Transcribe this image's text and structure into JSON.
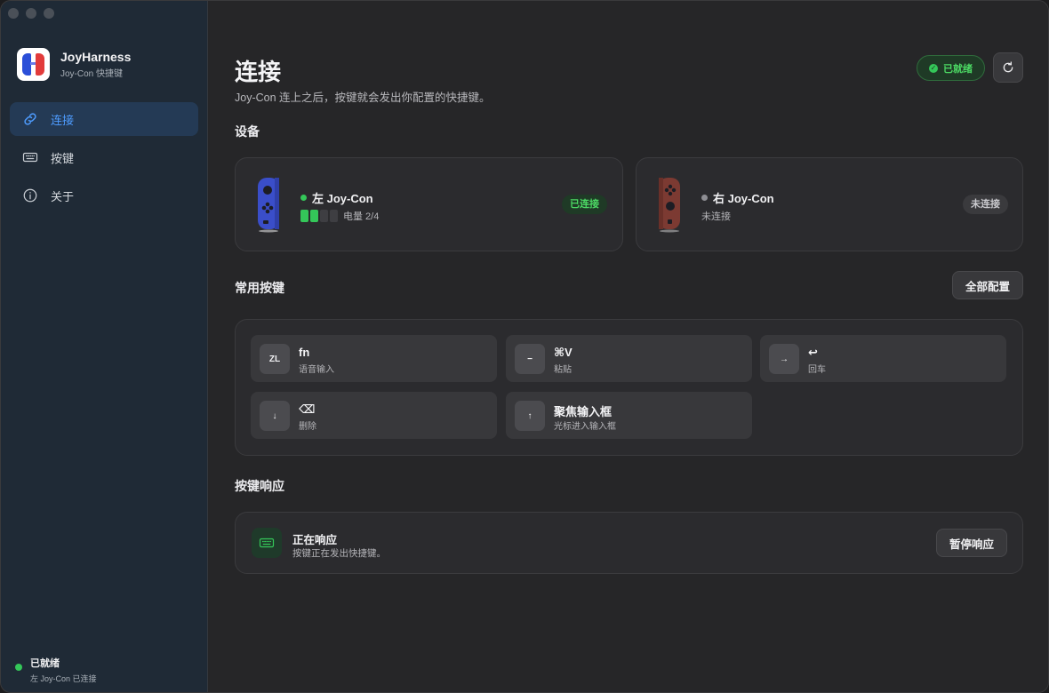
{
  "app": {
    "name": "JoyHarness",
    "subtitle": "Joy-Con 快捷键"
  },
  "sidebar": {
    "items": [
      {
        "label": "连接",
        "icon": "link-icon",
        "active": true
      },
      {
        "label": "按键",
        "icon": "keyboard-icon",
        "active": false
      },
      {
        "label": "关于",
        "icon": "info-icon",
        "active": false
      }
    ],
    "status": {
      "title": "已就绪",
      "detail": "左 Joy-Con 已连接"
    }
  },
  "header": {
    "title": "连接",
    "subtitle": "Joy-Con 连上之后，按键就会发出你配置的快捷键。",
    "status_pill": "已就绪"
  },
  "devices": {
    "section_title": "设备",
    "left": {
      "name": "左 Joy-Con",
      "battery_label": "电量 2/4",
      "battery_level": 2,
      "battery_max": 4,
      "badge": "已连接",
      "status_color": "#34c759"
    },
    "right": {
      "name": "右 Joy-Con",
      "status_text": "未连接",
      "badge": "未连接",
      "status_color": "#8e8e93"
    }
  },
  "shortcuts": {
    "section_title": "常用按键",
    "configure_all": "全部配置",
    "items": [
      {
        "key": "ZL",
        "name": "fn",
        "desc": "语音输入"
      },
      {
        "key": "−",
        "name": "⌘V",
        "desc": "粘贴"
      },
      {
        "key": "→",
        "name": "↩",
        "desc": "回车"
      },
      {
        "key": "↓",
        "name": "⌫",
        "desc": "删除"
      },
      {
        "key": "↑",
        "name": "聚焦输入框",
        "desc": "光标进入输入框"
      }
    ]
  },
  "response": {
    "section_title": "按键响应",
    "title": "正在响应",
    "subtitle": "按键正在发出快捷键。",
    "pause_label": "暂停响应"
  },
  "colors": {
    "accent": "#4e9cff",
    "success": "#34c759",
    "sidebar_bg": "#1f2a36"
  }
}
